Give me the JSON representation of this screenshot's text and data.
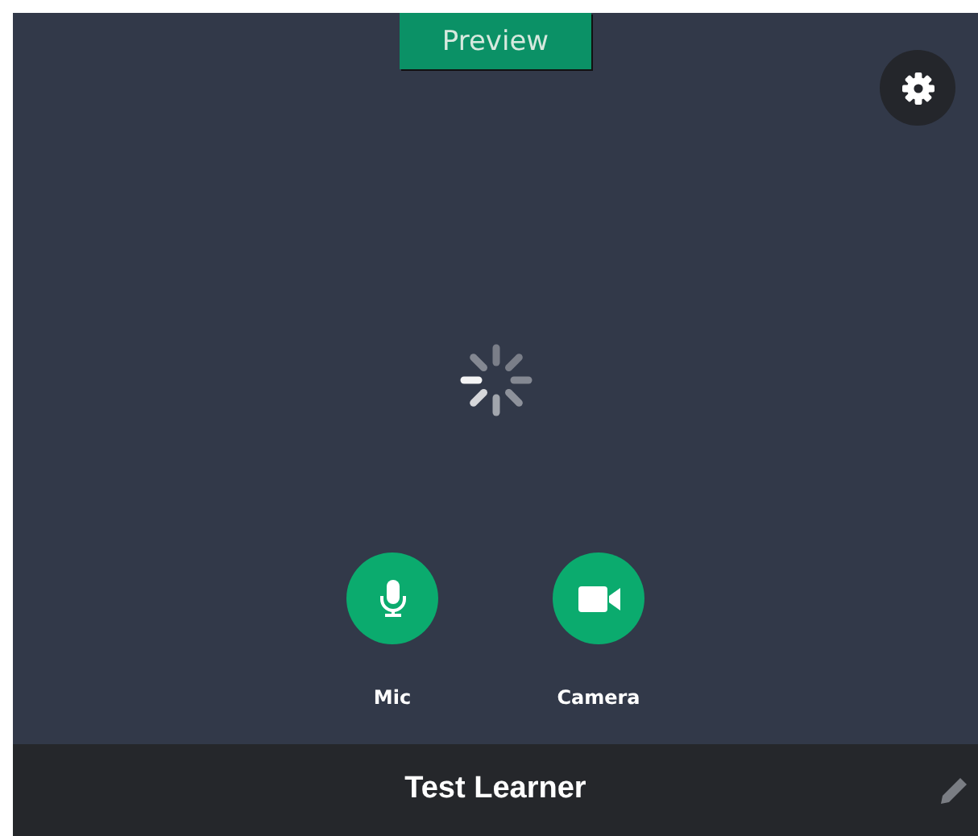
{
  "preview_tab": {
    "label": "Preview"
  },
  "controls": [
    {
      "kind": "mic",
      "label": "Mic"
    },
    {
      "kind": "camera",
      "label": "Camera"
    }
  ],
  "footer": {
    "name": "Test Learner"
  }
}
